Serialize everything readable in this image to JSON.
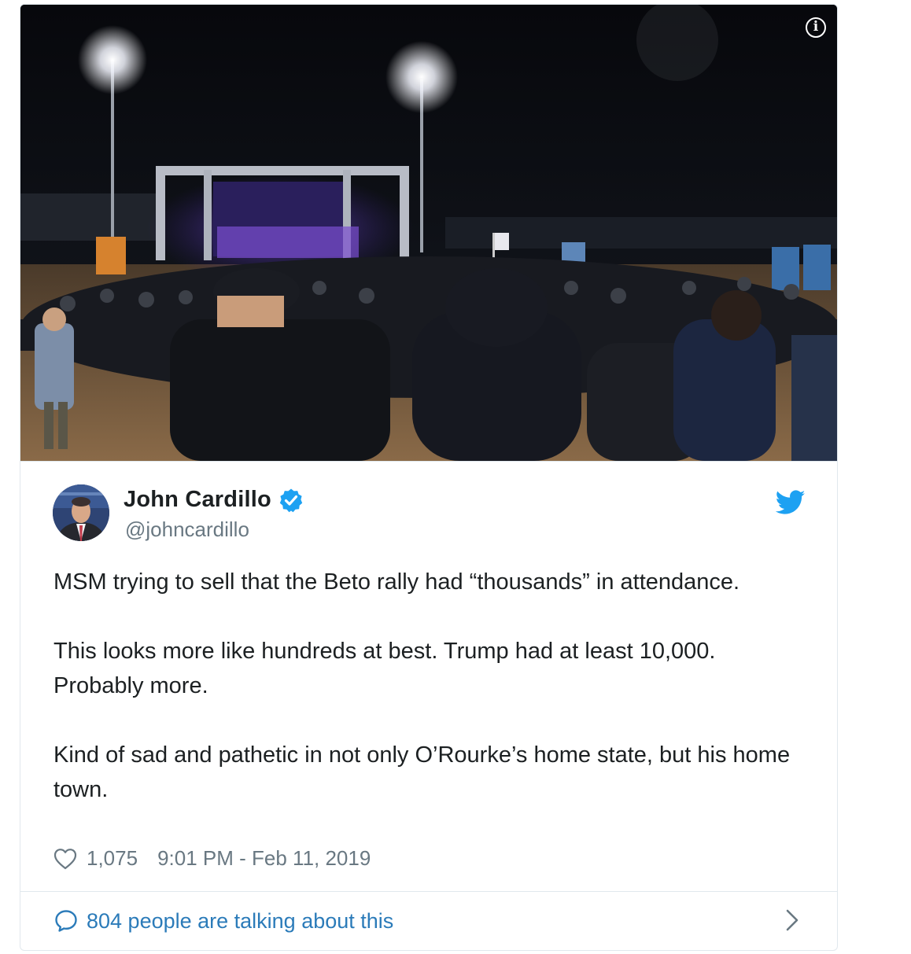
{
  "tweet": {
    "author_name": "John Cardillo",
    "author_handle": "@johncardillo",
    "verified": true,
    "paragraphs": [
      "MSM trying to sell that the Beto rally had “thousands” in attendance.",
      "This looks more like hundreds at best. Trump had at least 10,000. Probably more.",
      "Kind of sad and pathetic in not only O’Rourke’s home state, but his home town."
    ],
    "likes": "1,075",
    "timestamp": "9:01 PM - Feb 11, 2019",
    "conversation_link": "804 people are talking about this"
  },
  "icons": {
    "info": "info-icon",
    "verified": "verified-badge-icon",
    "brand": "twitter-bird-icon",
    "like": "heart-icon",
    "reply": "speech-bubble-icon",
    "more": "chevron-right-icon"
  },
  "colors": {
    "accent": "#1da1f2",
    "link": "#2b7bb9",
    "muted": "#697882",
    "text": "#1c2022",
    "border": "#e1e8ed"
  }
}
